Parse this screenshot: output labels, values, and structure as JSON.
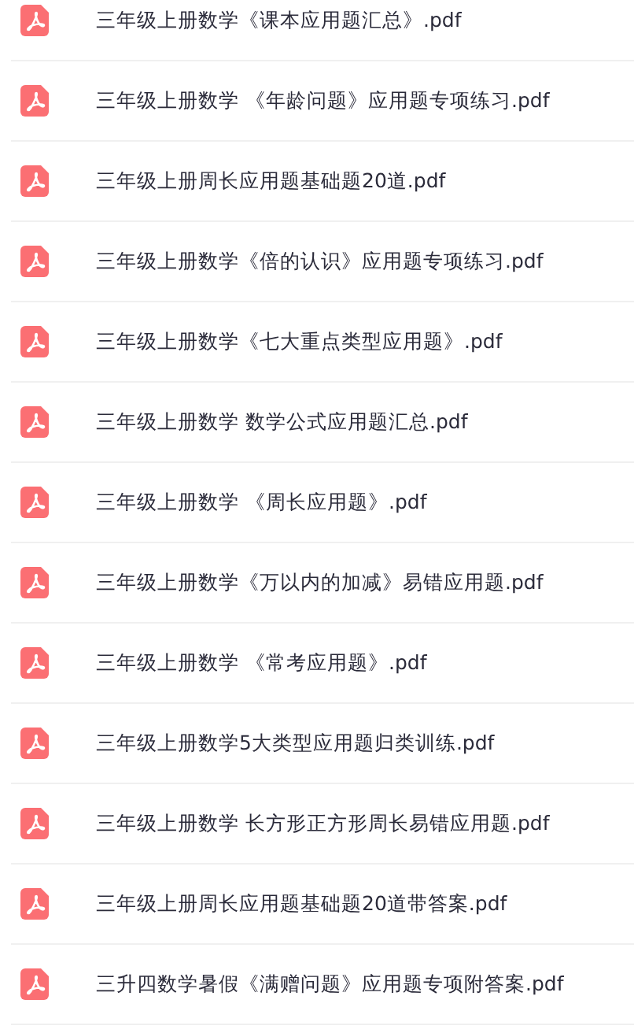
{
  "files": [
    {
      "name": "三年级上册数学《课本应用题汇总》.pdf"
    },
    {
      "name": "三年级上册数学 《年龄问题》应用题专项练习.pdf"
    },
    {
      "name": "三年级上册周长应用题基础题20道.pdf"
    },
    {
      "name": "三年级上册数学《倍的认识》应用题专项练习.pdf"
    },
    {
      "name": "三年级上册数学《七大重点类型应用题》.pdf"
    },
    {
      "name": "三年级上册数学 数学公式应用题汇总.pdf"
    },
    {
      "name": "三年级上册数学 《周长应用题》.pdf"
    },
    {
      "name": "三年级上册数学《万以内的加减》易错应用题.pdf"
    },
    {
      "name": "三年级上册数学 《常考应用题》.pdf"
    },
    {
      "name": "三年级上册数学5大类型应用题归类训练.pdf"
    },
    {
      "name": "三年级上册数学 长方形正方形周长易错应用题.pdf"
    },
    {
      "name": "三年级上册周长应用题基础题20道带答案.pdf"
    },
    {
      "name": "三升四数学暑假《满赠问题》应用题专项附答案.pdf"
    }
  ]
}
